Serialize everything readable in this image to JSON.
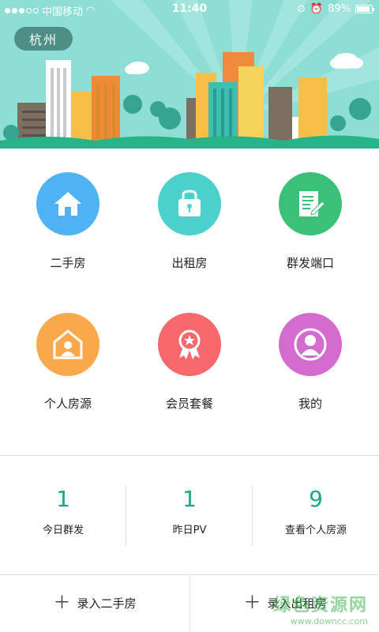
{
  "status_bar": {
    "carrier": "中国移动",
    "time": "11:40",
    "battery": "89%"
  },
  "header": {
    "city": "杭州"
  },
  "menu": [
    {
      "label": "二手房",
      "icon": "house-icon",
      "color": "#4fb3f3"
    },
    {
      "label": "出租房",
      "icon": "lock-icon",
      "color": "#4cd0cb"
    },
    {
      "label": "群发端口",
      "icon": "document-edit-icon",
      "color": "#3ac177"
    },
    {
      "label": "个人房源",
      "icon": "person-house-icon",
      "color": "#f9a94b"
    },
    {
      "label": "会员套餐",
      "icon": "award-ribbon-icon",
      "color": "#f6686b"
    },
    {
      "label": "我的",
      "icon": "user-profile-icon",
      "color": "#d46cd0"
    }
  ],
  "stats": [
    {
      "value": "1",
      "label": "今日群发"
    },
    {
      "value": "1",
      "label": "昨日PV"
    },
    {
      "value": "9",
      "label": "查看个人房源"
    }
  ],
  "actions": {
    "add_secondhand": "录入二手房",
    "add_rental": "录入出租房"
  },
  "watermark": {
    "title": "绿色资源网",
    "url": "www.downcc.com"
  },
  "colors": {
    "accent": "#1aa889",
    "banner_bg": "#8fded5"
  }
}
